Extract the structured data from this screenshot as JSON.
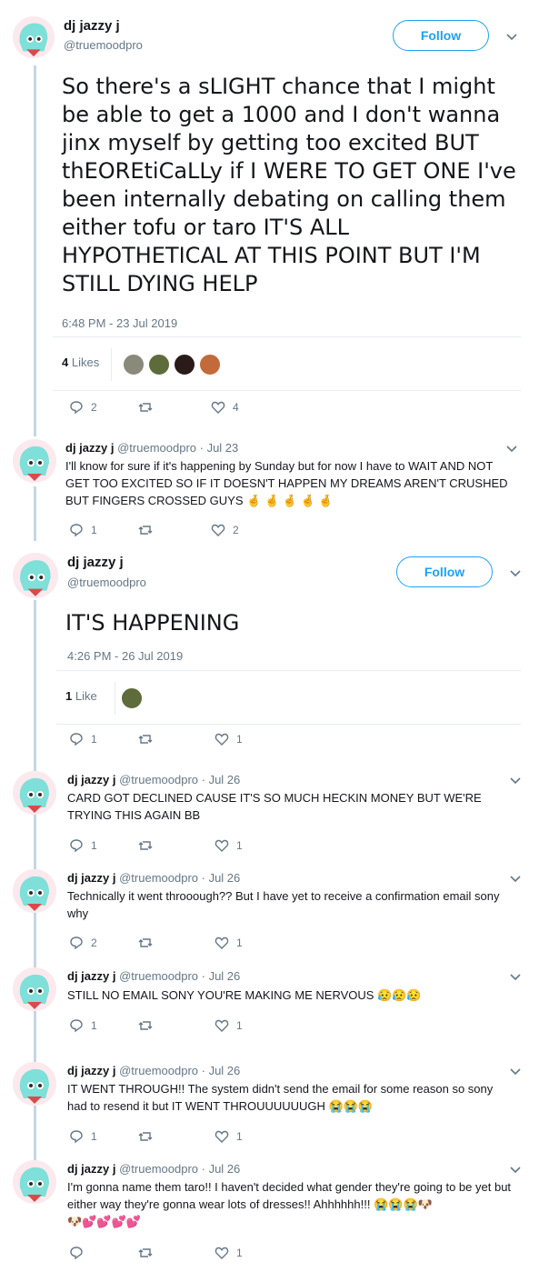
{
  "tweet1": {
    "name": "dj jazzy j",
    "handle": "@truemoodpro",
    "follow_label": "Follow",
    "text": "So there's a sLIGHT chance that I might be able to get a 1000 and I don't wanna jinx myself by getting too excited BUT thEOREtiCaLLy if I WERE TO GET ONE I've been internally debating on calling them either tofu or taro IT'S ALL HYPOTHETICAL AT THIS POINT BUT I'M STILL DYING HELP",
    "timestamp": "6:48 PM - 23 Jul 2019",
    "likes_count": "4",
    "likes_word": "Likes",
    "replies": "2",
    "retweets": "",
    "likes": "4"
  },
  "reply1": {
    "name": "dj jazzy j",
    "handle": "@truemoodpro",
    "date": "· Jul 23",
    "text": "I'll know for sure if it's happening by Sunday but for now I have to WAIT AND NOT GET TOO EXCITED SO IF IT DOESN'T HAPPEN MY DREAMS AREN'T CRUSHED BUT FINGERS CROSSED GUYS",
    "emoji": "🤞 🤞 🤞 🤞 🤞",
    "replies": "1",
    "likes": "2"
  },
  "tweet2": {
    "name": "dj jazzy j",
    "handle": "@truemoodpro",
    "follow_label": "Follow",
    "text": "IT'S HAPPENING",
    "timestamp": "4:26 PM - 26 Jul 2019",
    "likes_count": "1",
    "likes_word": "Like",
    "replies": "1",
    "likes": "1"
  },
  "reply2": {
    "name": "dj jazzy j",
    "handle": "@truemoodpro",
    "date": "· Jul 26",
    "text": "CARD GOT DECLINED CAUSE IT'S SO MUCH HECKIN MONEY BUT WE'RE TRYING THIS AGAIN BB",
    "replies": "1",
    "likes": "1"
  },
  "reply3": {
    "name": "dj jazzy j",
    "handle": "@truemoodpro",
    "date": "· Jul 26",
    "text": "Technically it went throoough?? But I have yet to receive a confirmation email sony why",
    "replies": "2",
    "likes": "1"
  },
  "reply4": {
    "name": "dj jazzy j",
    "handle": "@truemoodpro",
    "date": "· Jul 26",
    "text": "STILL NO EMAIL SONY YOU'RE MAKING ME NERVOUS",
    "emoji": "😥😥😥",
    "replies": "1",
    "likes": "1"
  },
  "reply5": {
    "name": "dj jazzy j",
    "handle": "@truemoodpro",
    "date": "· Jul 26",
    "text": "IT WENT THROUGH!! The system didn't send the email for some reason so sony had to resend it but IT WENT THROUUUUUUGH",
    "emoji": "😭😭😭",
    "replies": "1",
    "likes": "1"
  },
  "reply6": {
    "name": "dj jazzy j",
    "handle": "@truemoodpro",
    "date": "· Jul 26",
    "text": "I'm gonna name them taro!! I haven't decided what gender they're going to be yet but either way they're gonna wear lots of dresses!! Ahhhhhh!!!",
    "emoji": "😭😭😭🐶",
    "emoji2": "🐶💕💕💕💕",
    "replies": "",
    "likes": "1"
  },
  "colors": {
    "accent": "#1da1f2",
    "thread": "#c4d7e6",
    "muted": "#657786"
  }
}
